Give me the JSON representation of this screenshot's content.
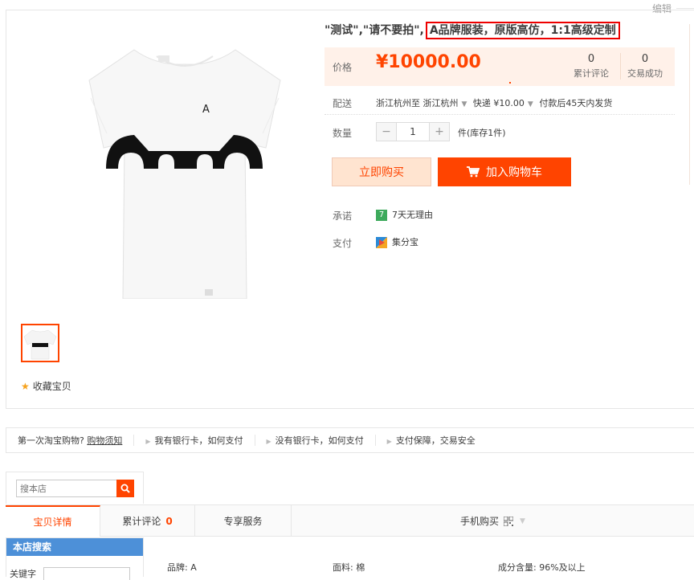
{
  "header": {
    "edit_label": "编辑"
  },
  "product": {
    "title_plain": "\"测试\",\"请不要拍\",",
    "title_highlight": "A品牌服装，原版高仿，1:1高级定制",
    "price_label": "价格",
    "price": "¥10000.00",
    "stats": [
      {
        "count": "0",
        "label": "累计评论"
      },
      {
        "count": "0",
        "label": "交易成功"
      }
    ],
    "shipping": {
      "label": "配送",
      "from_to": "浙江杭州至",
      "destination": "浙江杭州",
      "method": "快递 ¥10.00",
      "eta": "付款后45天内发货"
    },
    "quantity": {
      "label": "数量",
      "minus": "−",
      "value": "1",
      "plus": "+",
      "stock": "件(库存1件)"
    },
    "buy_now": "立即购买",
    "add_to_cart": "加入购物车",
    "promise_label": "承诺",
    "promise_text": "7天无理由",
    "promise_badge": "7",
    "pay_label": "支付",
    "pay_text": "集分宝",
    "favorite": "收藏宝贝",
    "tshirt_letter": "A"
  },
  "guide_bar": {
    "first_q": "第一次淘宝购物?",
    "first_link": "购物须知",
    "items": [
      "我有银行卡，如何支付",
      "没有银行卡，如何支付",
      "支付保障，交易安全"
    ]
  },
  "store_search": {
    "placeholder": "搜本店"
  },
  "tabs": {
    "detail": "宝贝详情",
    "reviews": "累计评论",
    "reviews_count": "0",
    "service": "专享服务",
    "mobile": "手机购买"
  },
  "sidebar": {
    "title": "本店搜索",
    "keyword_label": "关键字"
  },
  "attributes": [
    "品牌: A",
    "面料: 棉",
    "成分含量: 96%及以上"
  ],
  "colors": {
    "accent": "#ff4400",
    "price_bg": "#fff1e9",
    "side_head": "#4d90d8"
  }
}
